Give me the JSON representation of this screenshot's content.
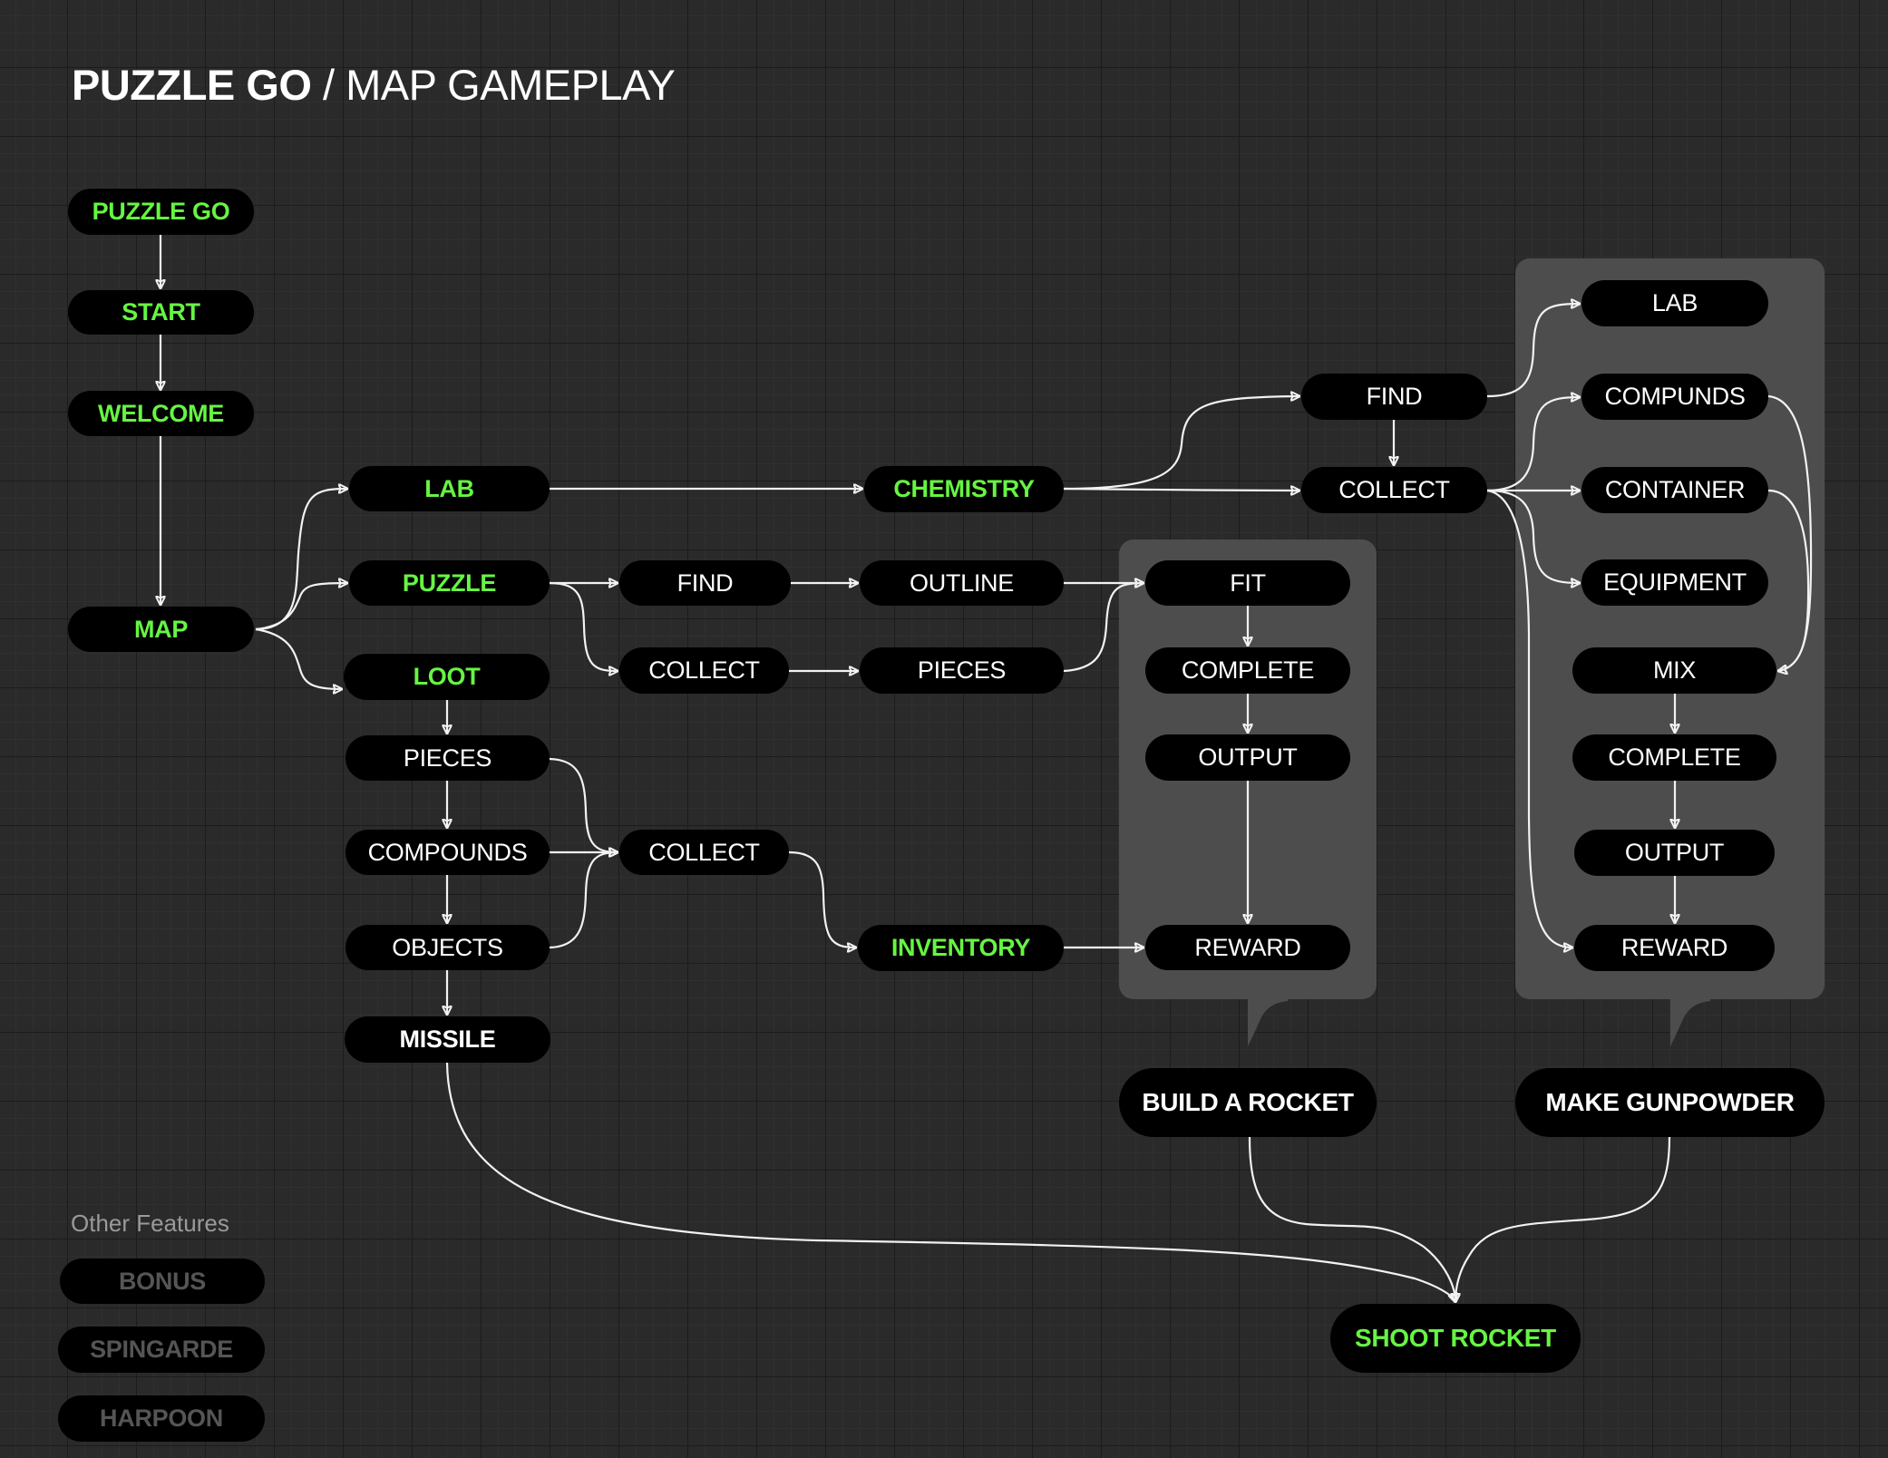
{
  "title": {
    "bold": "PUZZLE GO",
    "rest": " / MAP GAMEPLAY"
  },
  "nodes": {
    "puzzle_go": "PUZZLE GO",
    "start": "START",
    "welcome": "WELCOME",
    "map": "MAP",
    "lab": "LAB",
    "puzzle": "PUZZLE",
    "loot": "LOOT",
    "loot_pieces": "PIECES",
    "loot_compounds": "COMPOUNDS",
    "loot_objects": "OBJECTS",
    "missile": "MISSILE",
    "loot_collect": "COLLECT",
    "inventory": "INVENTORY",
    "puzzle_find": "FIND",
    "puzzle_collect": "COLLECT",
    "outline": "OUTLINE",
    "puzzle_pieces": "PIECES",
    "chemistry": "CHEMISTRY",
    "chem_find": "FIND",
    "chem_collect": "COLLECT",
    "rocket_fit": "FIT",
    "rocket_complete": "COMPLETE",
    "rocket_output": "OUTPUT",
    "rocket_reward": "REWARD",
    "gp_lab": "LAB",
    "gp_compunds": "COMPUNDS",
    "gp_container": "CONTAINER",
    "gp_equipment": "EQUIPMENT",
    "gp_mix": "MIX",
    "gp_complete": "COMPLETE",
    "gp_output": "OUTPUT",
    "gp_reward": "REWARD",
    "build_rocket": "BUILD A ROCKET",
    "make_gunpowder": "MAKE GUNPOWDER",
    "shoot_rocket": "SHOOT ROCKET"
  },
  "other_features": {
    "label": "Other Features",
    "items": [
      "BONUS",
      "SPINGARDE",
      "HARPOON"
    ]
  },
  "colors": {
    "background": "#2a2a2a",
    "node": "#000000",
    "highlight": "#66f542",
    "panel": "#4d4d4d",
    "disabled_text": "#555555",
    "edge": "#f2f2f2"
  }
}
